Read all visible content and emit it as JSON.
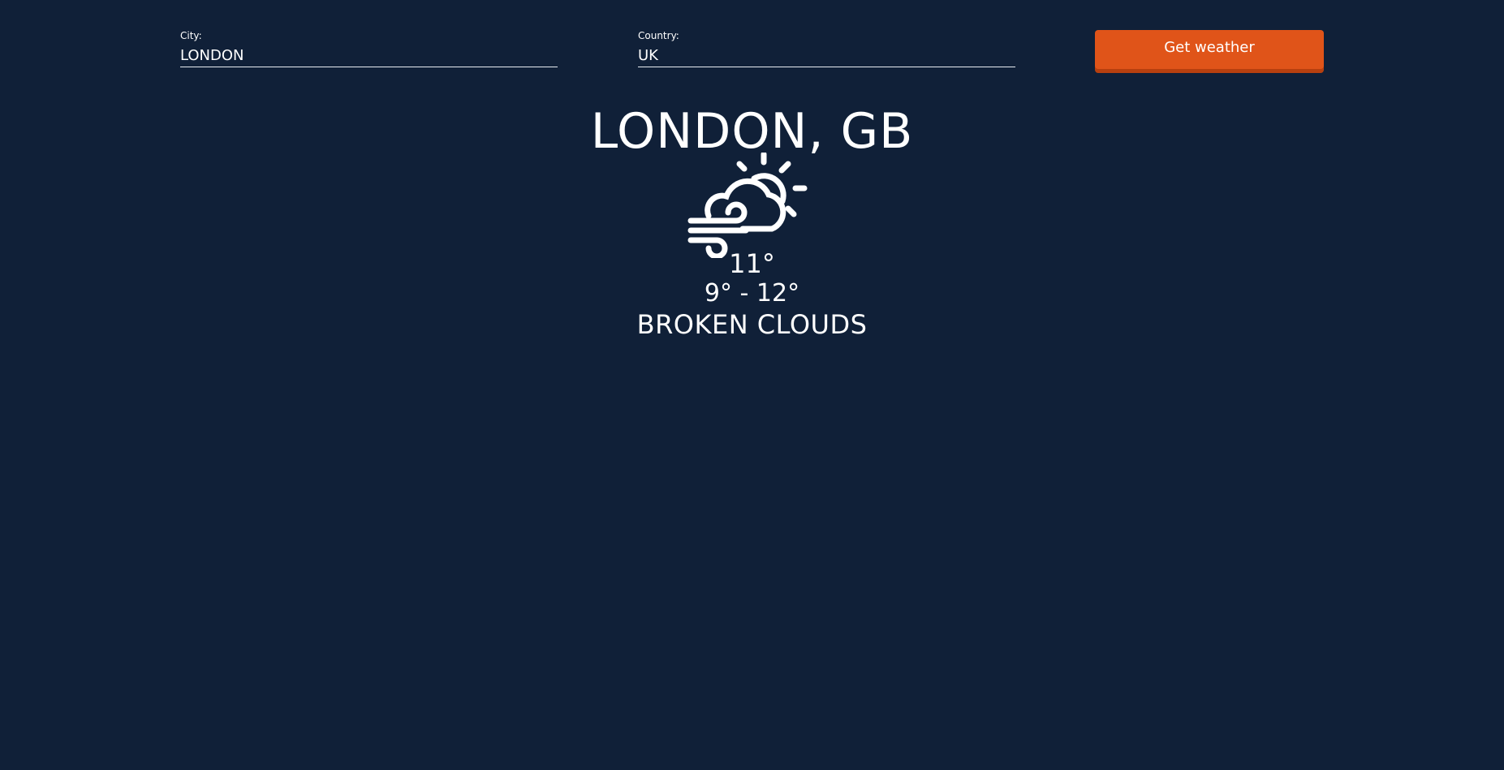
{
  "form": {
    "city_label": "City:",
    "city_value": "LONDON",
    "country_label": "Country:",
    "country_value": "UK",
    "submit_label": "Get weather"
  },
  "weather": {
    "location": "LONDON, GB",
    "icon": "wind-cloud-sun-icon",
    "temperature": "11°",
    "range": "9° - 12°",
    "description": "BROKEN CLOUDS"
  },
  "colors": {
    "background": "#102038",
    "accent": "#e05419",
    "text": "#ffffff"
  }
}
